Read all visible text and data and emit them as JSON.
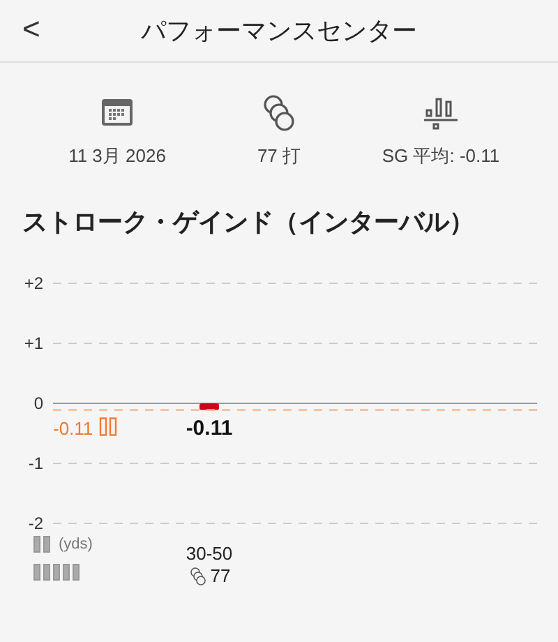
{
  "header": {
    "back": "<",
    "title": "パフォーマンスセンター"
  },
  "stats": [
    {
      "kind": "calendar",
      "label": "11 3月 2026"
    },
    {
      "kind": "balls",
      "label": "77 打"
    },
    {
      "kind": "bars",
      "label": "SG 平均: -0.11"
    }
  ],
  "section_title": "ストローク・ゲインド（インターバル）",
  "chart": {
    "chart_data": {
      "type": "bar",
      "categories": [
        "30-50"
      ],
      "values": [
        -0.11
      ],
      "ylim": [
        -2,
        2
      ],
      "yticks": [
        {
          "value": 2,
          "label": "+2"
        },
        {
          "value": 1,
          "label": "+1"
        },
        {
          "value": 0,
          "label": "0"
        },
        {
          "value": -1,
          "label": "-1"
        },
        {
          "value": -2,
          "label": "-2"
        }
      ],
      "data_labels": true
    },
    "average_label": "-0.11",
    "unit_label": "(yds)",
    "counts": [
      "77"
    ]
  }
}
